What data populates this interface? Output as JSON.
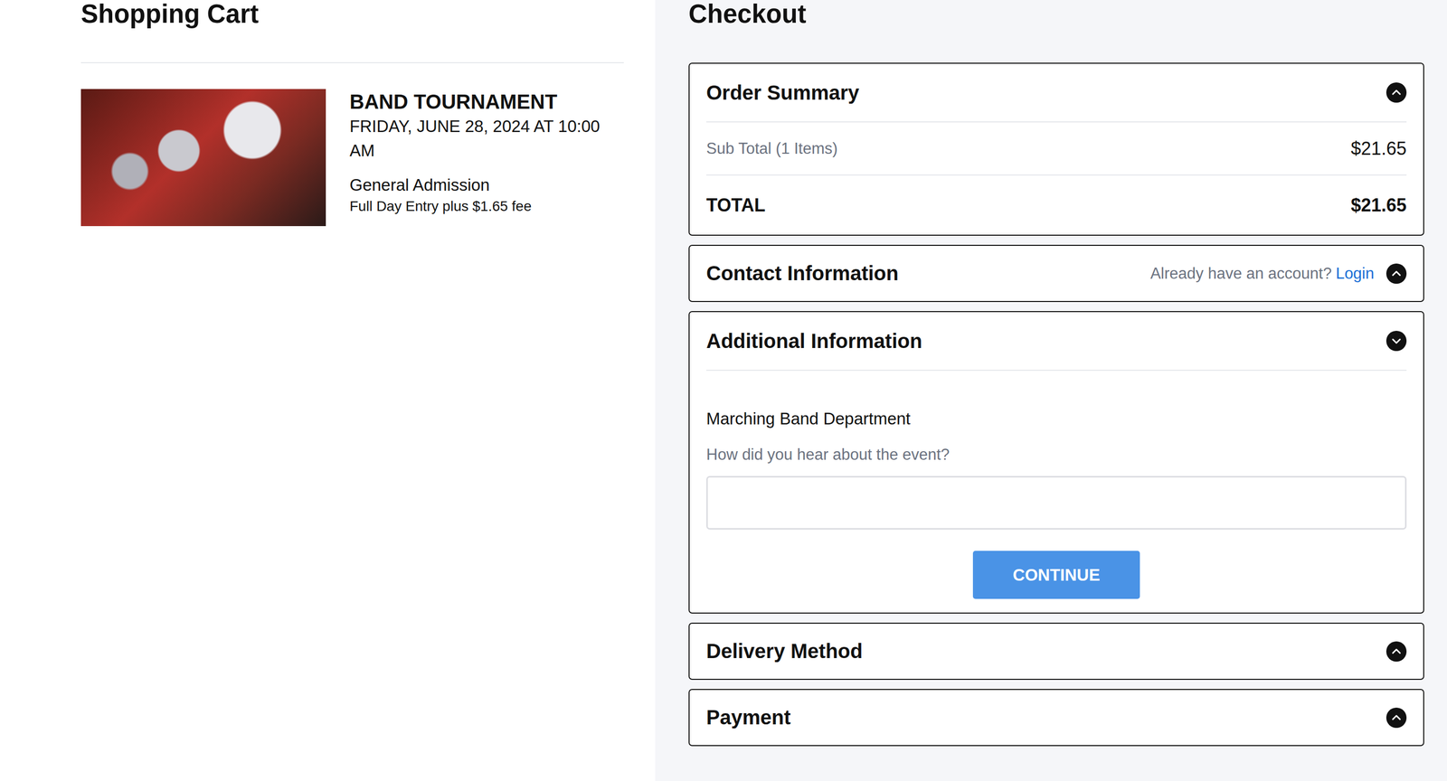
{
  "cart": {
    "title": "Shopping Cart",
    "items": [
      {
        "name": "BAND TOURNAMENT",
        "date": "FRIDAY, JUNE 28, 2024 AT 10:00 AM",
        "ticket": "General Admission",
        "description": "Full Day Entry plus $1.65 fee"
      }
    ]
  },
  "checkout": {
    "title": "Checkout",
    "sections": [
      {
        "kind": "summary",
        "title": "Order Summary",
        "expanded": true,
        "chevron_up": true,
        "rows": [
          {
            "kind": "subtotal",
            "label": "Sub Total (1 Items)",
            "value": "$21.65"
          },
          {
            "kind": "total",
            "label": "TOTAL",
            "value": "$21.65"
          }
        ]
      },
      {
        "kind": "contact",
        "title": "Contact Information",
        "expanded": false,
        "chevron_up": true,
        "prompt": "Already have an account?",
        "link": "Login"
      },
      {
        "kind": "form",
        "title": "Additional Information",
        "expanded": true,
        "chevron_up": false,
        "department": "Marching Band Department",
        "question": "How did you hear about the event?",
        "answer": "",
        "button": "CONTINUE"
      },
      {
        "kind": "plain",
        "title": "Delivery Method",
        "expanded": false,
        "chevron_up": true
      },
      {
        "kind": "plain",
        "title": "Payment",
        "expanded": false,
        "chevron_up": true
      }
    ]
  }
}
